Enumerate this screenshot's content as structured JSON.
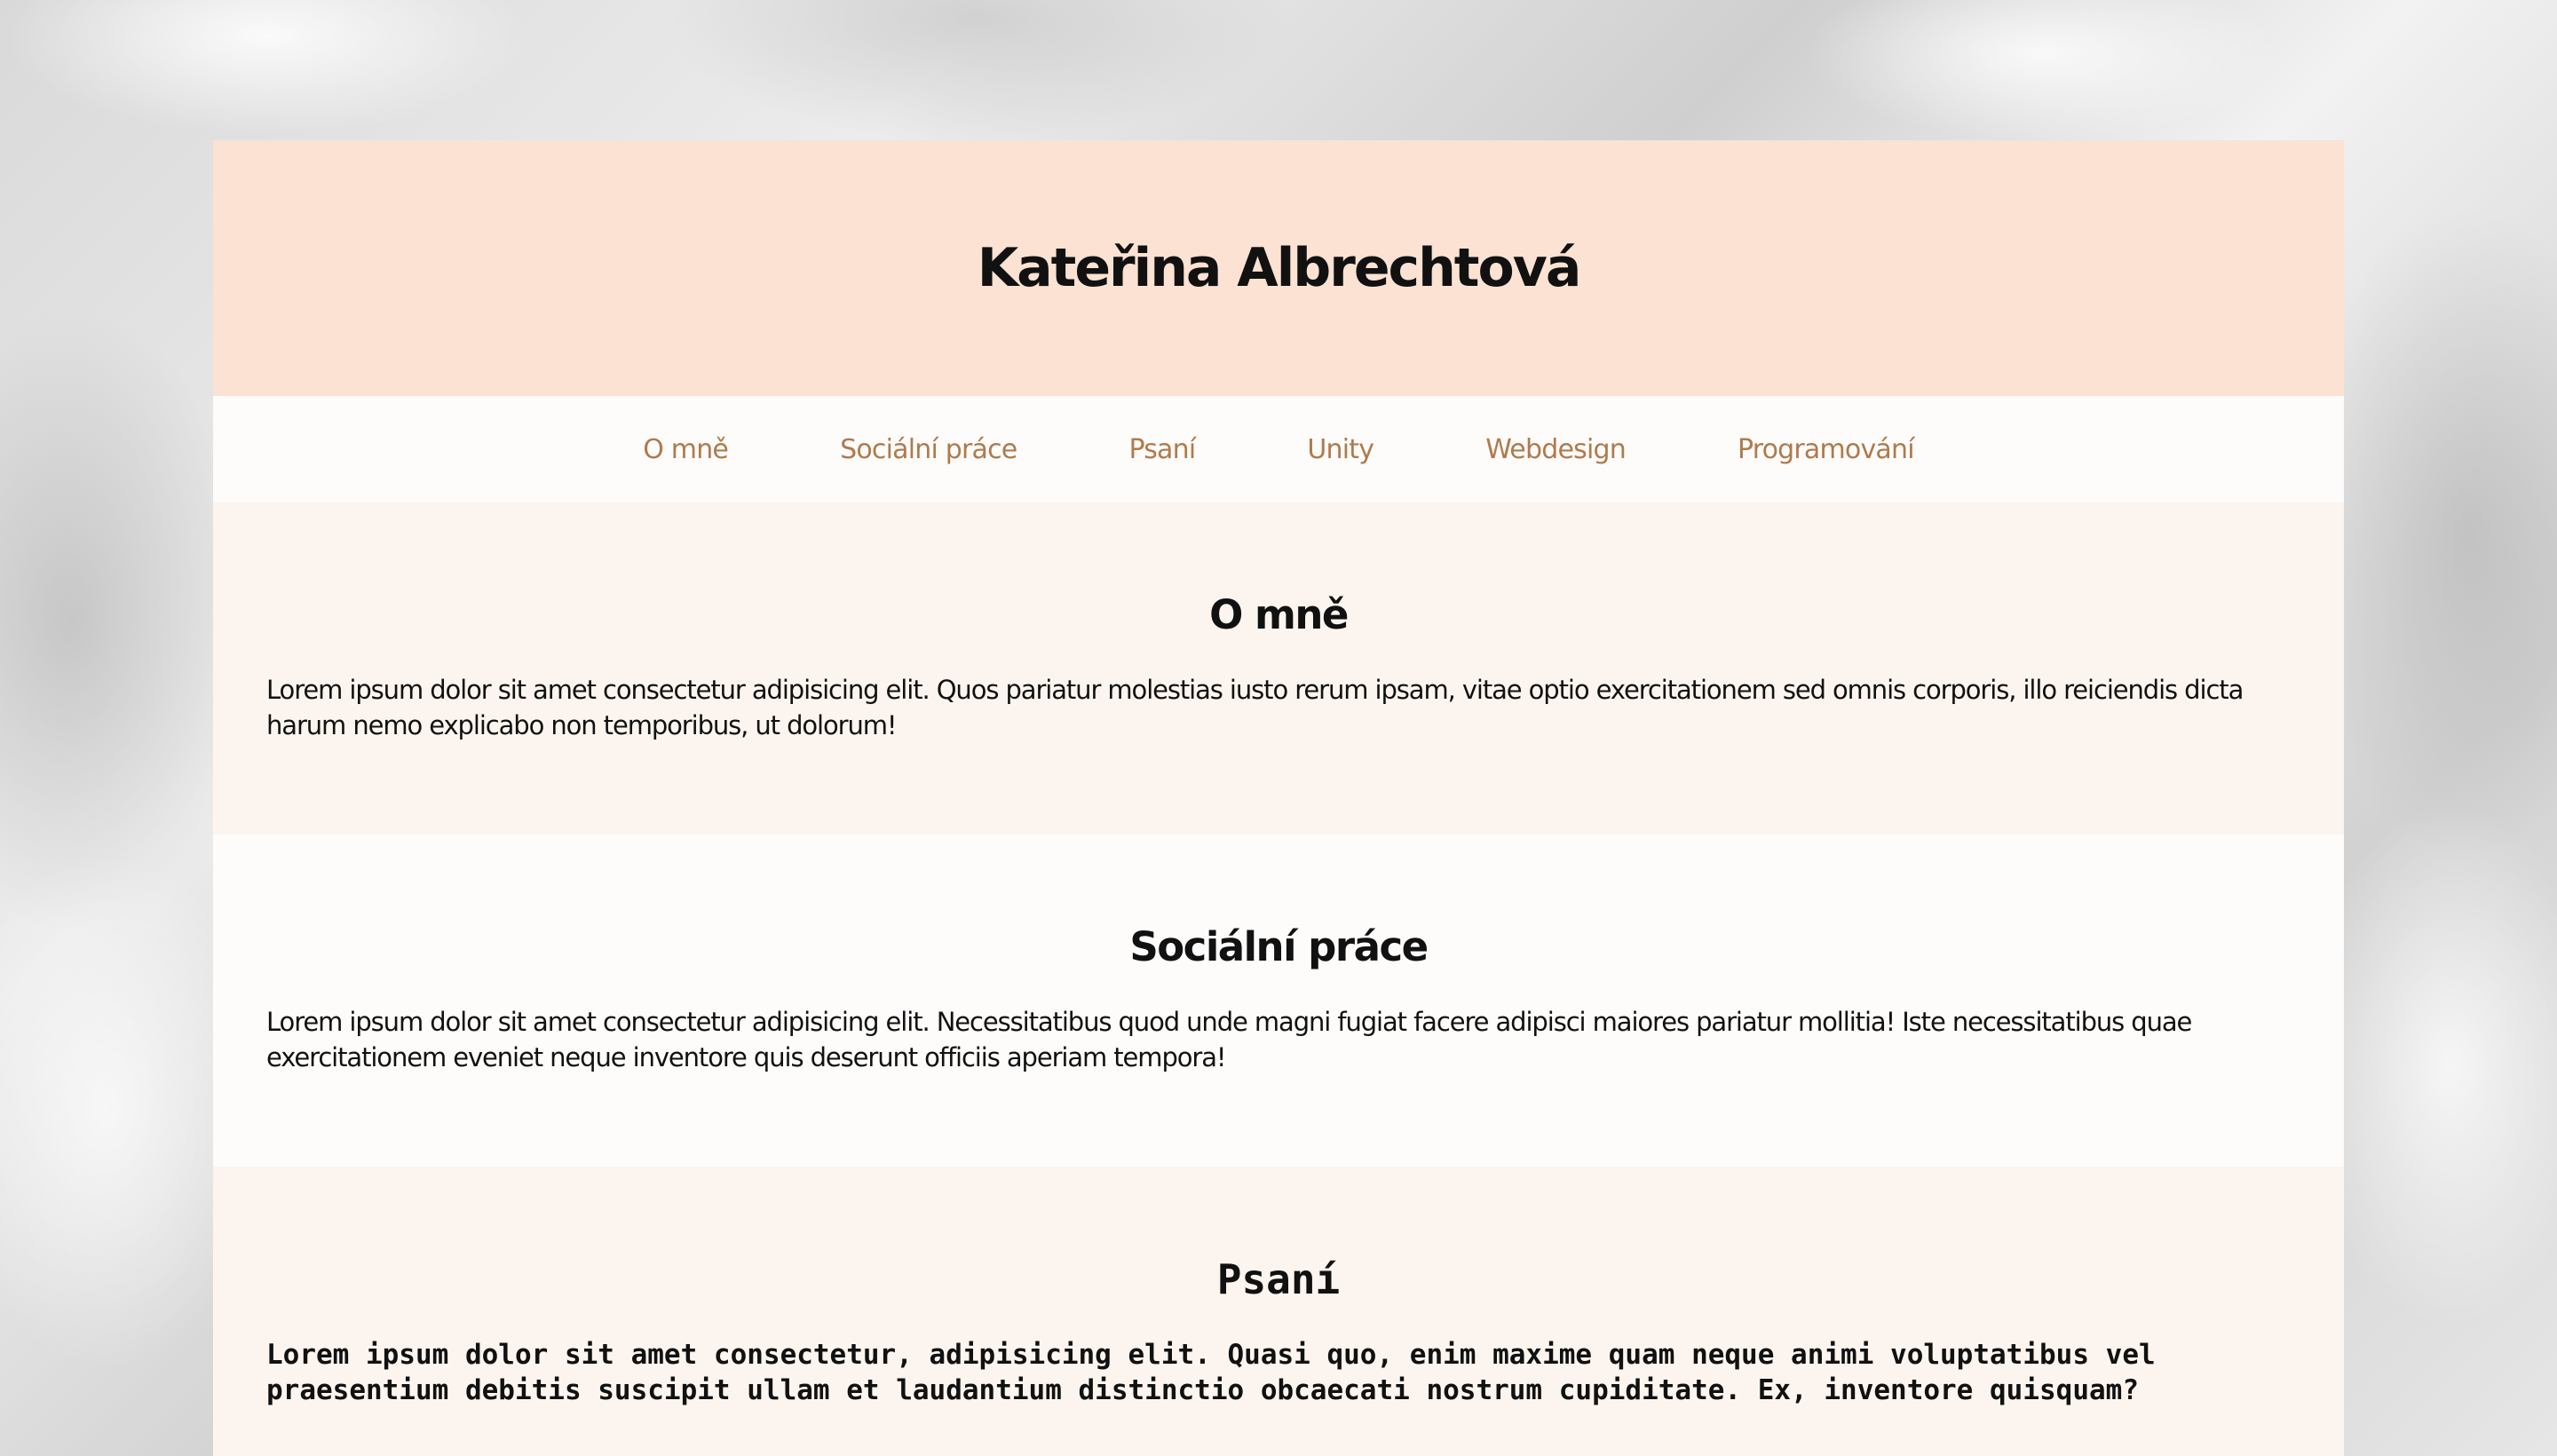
{
  "header": {
    "title": "Kateřina Albrechtová"
  },
  "nav": {
    "items": [
      {
        "label": "O mně"
      },
      {
        "label": "Sociální práce"
      },
      {
        "label": "Psaní"
      },
      {
        "label": "Unity"
      },
      {
        "label": "Webdesign"
      },
      {
        "label": "Programování"
      }
    ]
  },
  "sections": [
    {
      "heading": "O mně",
      "text": "Lorem ipsum dolor sit amet consectetur adipisicing elit. Quos pariatur molestias iusto rerum ipsam, vitae optio exercitationem sed omnis corporis, illo reiciendis dicta harum nemo explicabo non temporibus, ut dolorum!"
    },
    {
      "heading": "Sociální práce",
      "text": "Lorem ipsum dolor sit amet consectetur adipisicing elit. Necessitatibus quod unde magni fugiat facere adipisci maiores pariatur mollitia! Iste necessitatibus quae exercitationem eveniet neque inventore quis deserunt officiis aperiam tempora!"
    },
    {
      "heading": "Psaní",
      "text": "Lorem ipsum dolor sit amet consectetur, adipisicing elit. Quasi quo, enim maxime quam neque animi voluptatibus vel praesentium debitis suscipit ullam et laudantium distinctio obcaecati nostrum cupiditate. Ex, inventore quisquam?"
    }
  ],
  "colors": {
    "header_bg": "#fbe2d2",
    "nav_link": "#b07a4c",
    "section_alt_bg": "#fcf5ef",
    "page_bg": "#fdfcfb"
  }
}
